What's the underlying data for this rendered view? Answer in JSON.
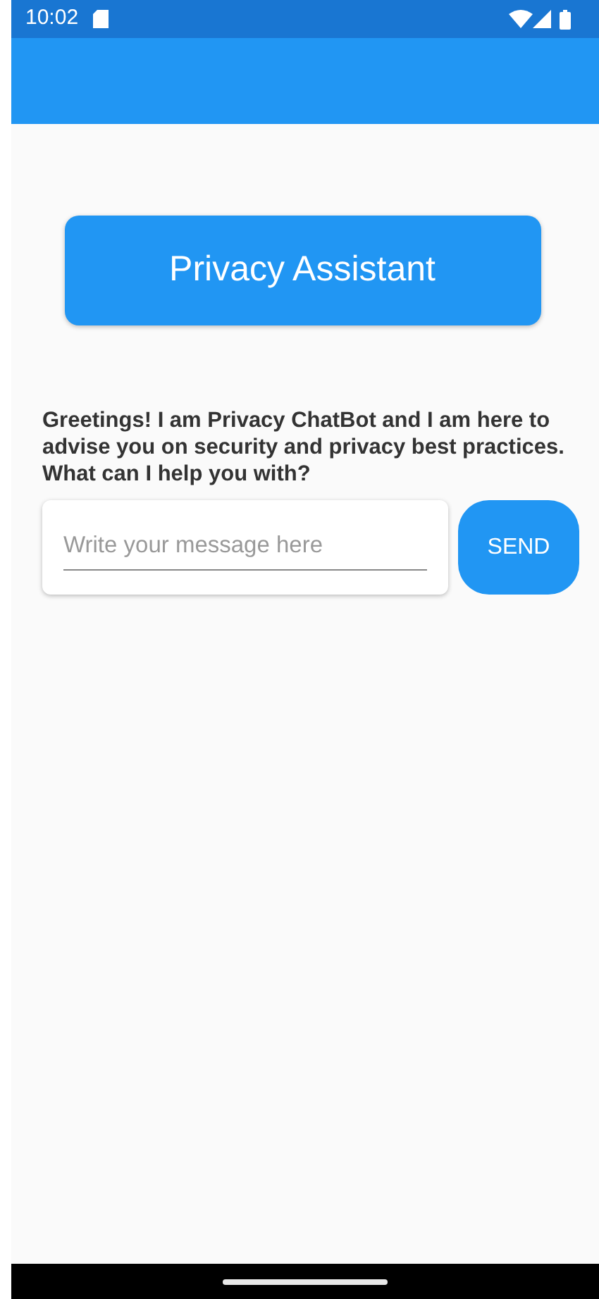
{
  "status_bar": {
    "time": "10:02"
  },
  "title_button": {
    "label": "Privacy Assistant"
  },
  "greeting": "Greetings! I am Privacy ChatBot and I am here to advise you on security and privacy best practices. What can I help you with?",
  "message_field": {
    "placeholder": "Write your message here"
  },
  "send_button": {
    "label": "SEND"
  }
}
